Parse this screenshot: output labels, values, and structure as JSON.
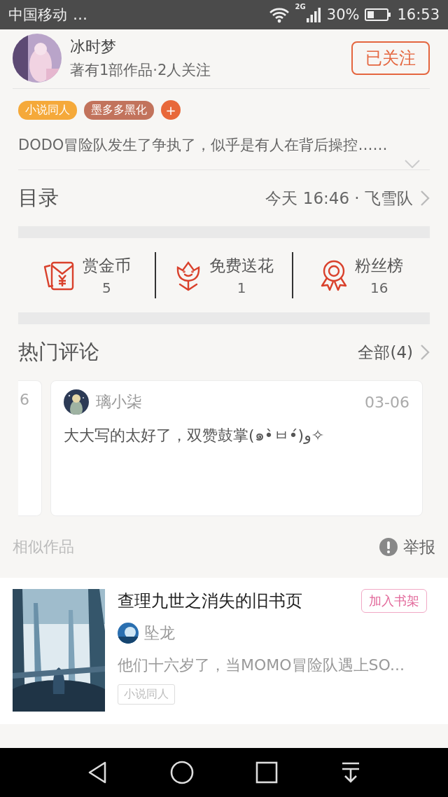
{
  "status_bar": {
    "carrier": "中国移动",
    "notification": "…",
    "network": "2G",
    "battery": "30%",
    "time": "16:53"
  },
  "author": {
    "name": "冰时梦",
    "stats": "著有1部作品·2人关注",
    "follow_button": {
      "label": "已关注",
      "following": true
    }
  },
  "tags": [
    {
      "label": "小说同人",
      "color": "#f5a93a"
    },
    {
      "label": "墨多多黑化",
      "color": "#c2735c"
    }
  ],
  "add_tag": "+",
  "description": "DODO冒险队发生了争执了，似乎是有人在背后操控……",
  "catalog": {
    "title": "目录",
    "latest": "今天 16:46 · 飞雪队"
  },
  "stats": [
    {
      "kind": "reward",
      "label": "赏金币",
      "count": "5"
    },
    {
      "kind": "flower",
      "label": "免费送花",
      "count": "1"
    },
    {
      "kind": "fans",
      "label": "粉丝榜",
      "count": "16"
    }
  ],
  "comments": {
    "title": "热门评论",
    "all_link": "全部(4)",
    "items": [
      {
        "kind": "clipped",
        "date": "6"
      },
      {
        "kind": "full",
        "author": "璃小柒",
        "date": "03-06",
        "text": "大大写的太好了，双赞鼓掌(๑•̀ㅂ•́)و✧"
      }
    ]
  },
  "similar": {
    "title": "相似作品",
    "report": "举报",
    "books": [
      {
        "title": "查理九世之消失的旧书页",
        "button": "加入书架",
        "author": "坠龙",
        "description": "他们十六岁了，当MOMO冒险队遇上SO...",
        "tag": "小说同人"
      }
    ]
  }
}
